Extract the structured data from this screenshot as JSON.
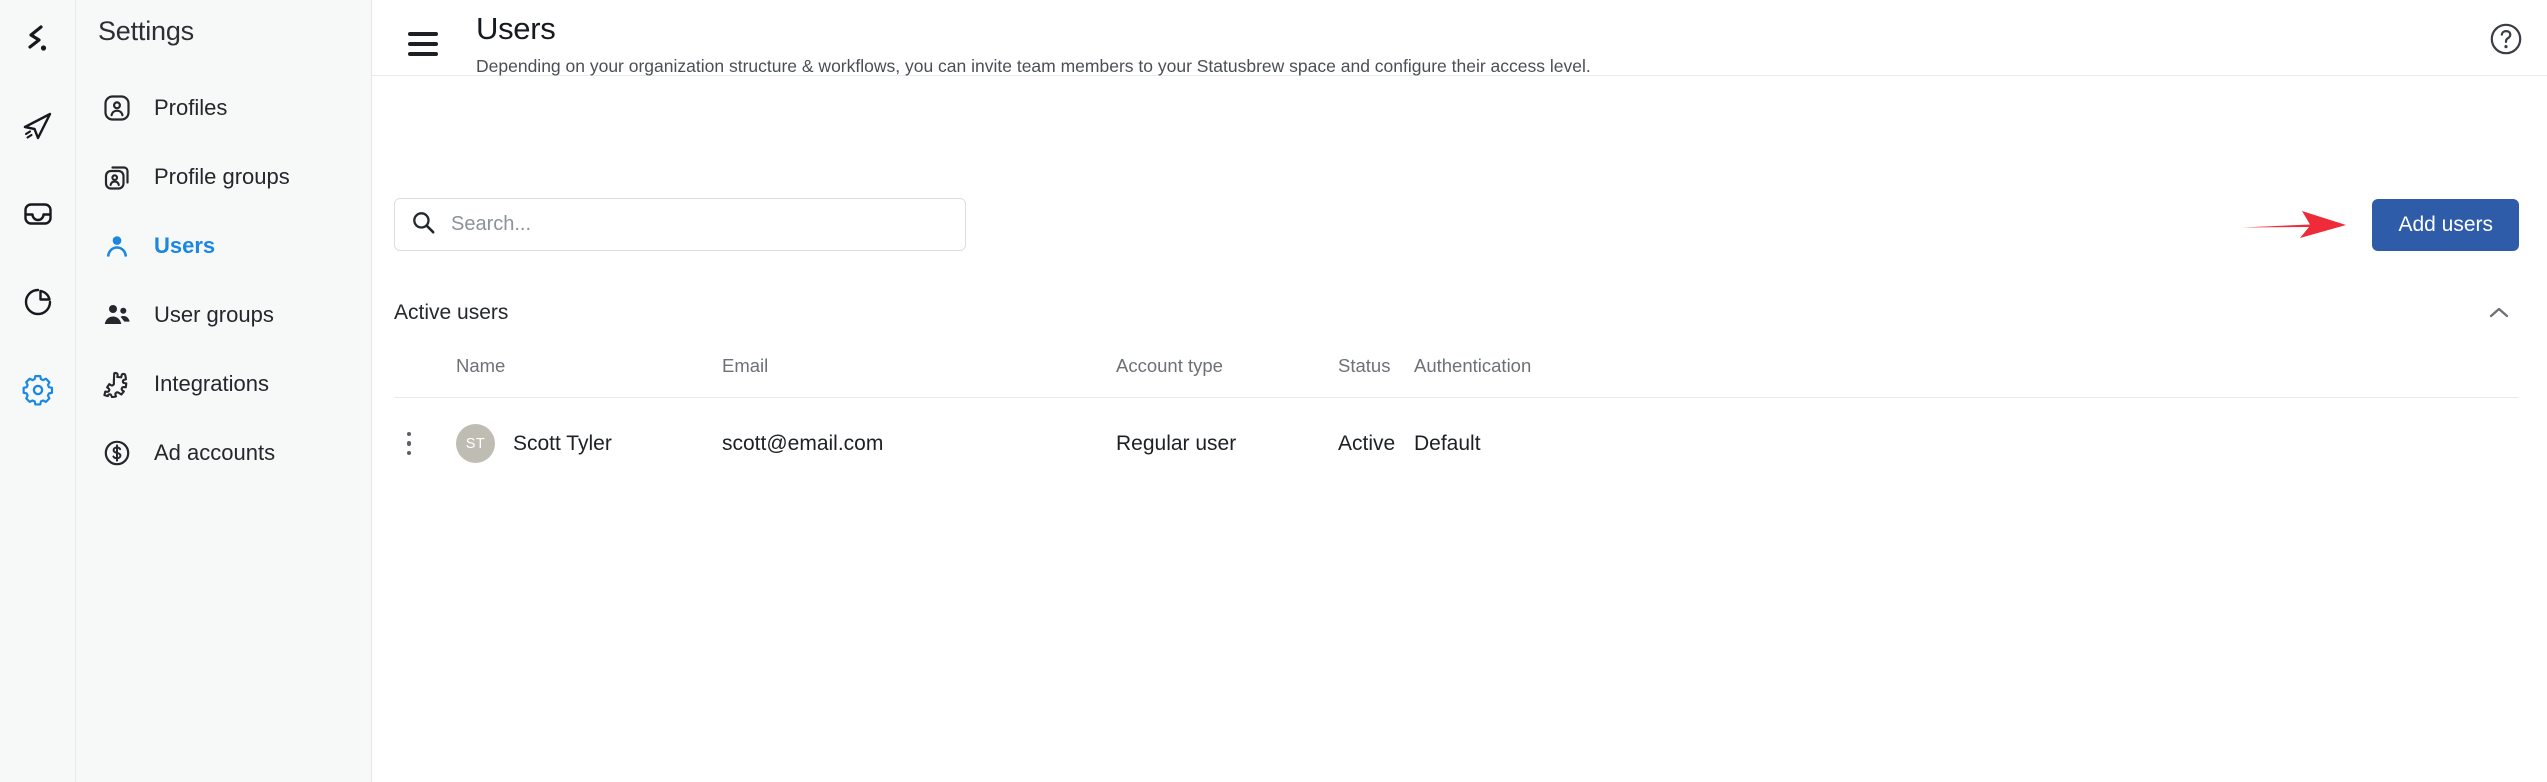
{
  "colors": {
    "accent": "#1a87e3",
    "button_blue": "#2f5ca8",
    "annotation_red": "#ef2b39",
    "rail_bg": "#f7f8f8",
    "avatar_bg": "#bfbcb3"
  },
  "rail": {
    "logo_icon": "statusbrew-logo-icon",
    "items": [
      {
        "icon": "paper-plane-icon",
        "name": "publish"
      },
      {
        "icon": "inbox-tray-icon",
        "name": "inbox"
      },
      {
        "icon": "pie-chart-icon",
        "name": "reports"
      },
      {
        "icon": "gear-icon",
        "name": "settings",
        "active": true
      }
    ]
  },
  "sidebar": {
    "title": "Settings",
    "items": [
      {
        "label": "Profiles",
        "icon": "profile-card-icon",
        "active": false
      },
      {
        "label": "Profile groups",
        "icon": "profile-cards-stack-icon",
        "active": false
      },
      {
        "label": "Users",
        "icon": "person-icon",
        "active": true
      },
      {
        "label": "User groups",
        "icon": "people-icon",
        "active": false
      },
      {
        "label": "Integrations",
        "icon": "puzzle-piece-icon",
        "active": false
      },
      {
        "label": "Ad accounts",
        "icon": "dollar-circle-icon",
        "active": false
      }
    ]
  },
  "header": {
    "menu_icon": "hamburger-menu-icon",
    "title": "Users",
    "description": "Depending on your organization structure & workflows, you can invite team members to your Statusbrew space and configure their access level.",
    "help_icon": "question-circle-icon"
  },
  "toolbar": {
    "search_placeholder": "Search...",
    "search_value": "",
    "search_icon": "search-icon",
    "add_users_label": "Add users"
  },
  "annotation": {
    "type": "arrow",
    "direction": "right",
    "color": "#ef2b39",
    "points_to": "add-users-button"
  },
  "section": {
    "title": "Active users",
    "collapse_icon": "chevron-up-icon",
    "expanded": true
  },
  "table": {
    "columns": [
      "Name",
      "Email",
      "Account type",
      "Status",
      "Authentication"
    ],
    "rows": [
      {
        "initials": "ST",
        "name": "Scott Tyler",
        "email": "scott@email.com",
        "account_type": "Regular user",
        "status": "Active",
        "authentication": "Default",
        "row_menu_icon": "kebab-menu-icon"
      }
    ]
  }
}
